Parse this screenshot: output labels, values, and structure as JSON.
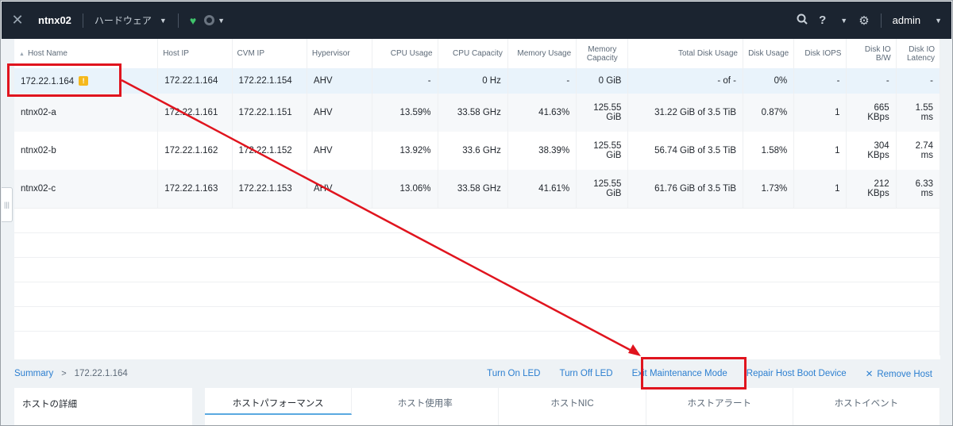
{
  "topbar": {
    "cluster_name": "ntnx02",
    "view_label": "ハードウェア",
    "admin_label": "admin",
    "help_label": "?"
  },
  "table": {
    "headers": [
      "Host Name",
      "Host IP",
      "CVM IP",
      "Hypervisor",
      "CPU Usage",
      "CPU Capacity",
      "Memory Usage",
      "Memory Capacity",
      "Total Disk Usage",
      "Disk Usage",
      "Disk IOPS",
      "Disk IO B/W",
      "Disk IO Latency"
    ],
    "rows": [
      [
        "172.22.1.164",
        "172.22.1.164",
        "172.22.1.154",
        "AHV",
        "-",
        "0 Hz",
        "-",
        "0 GiB",
        "- of -",
        "0%",
        "-",
        "-",
        "-"
      ],
      [
        "ntnx02-a",
        "172.22.1.161",
        "172.22.1.151",
        "AHV",
        "13.59%",
        "33.58 GHz",
        "41.63%",
        "125.55 GiB",
        "31.22 GiB of 3.5 TiB",
        "0.87%",
        "1",
        "665 KBps",
        "1.55 ms"
      ],
      [
        "ntnx02-b",
        "172.22.1.162",
        "172.22.1.152",
        "AHV",
        "13.92%",
        "33.6 GHz",
        "38.39%",
        "125.55 GiB",
        "56.74 GiB of 3.5 TiB",
        "1.58%",
        "1",
        "304 KBps",
        "2.74 ms"
      ],
      [
        "ntnx02-c",
        "172.22.1.163",
        "172.22.1.153",
        "AHV",
        "13.06%",
        "33.58 GHz",
        "41.61%",
        "125.55 GiB",
        "61.76 GiB of 3.5 TiB",
        "1.73%",
        "1",
        "212 KBps",
        "6.33 ms"
      ]
    ],
    "warning_badge": "!"
  },
  "breadcrumb": {
    "root": "Summary",
    "current": "172.22.1.164"
  },
  "actions": {
    "turn_on_led": "Turn On LED",
    "turn_off_led": "Turn Off LED",
    "exit_maintenance": "Exit Maintenance Mode",
    "repair_boot": "Repair Host Boot Device",
    "remove_host": "Remove Host"
  },
  "details": {
    "title": "ホストの詳細"
  },
  "tabs": [
    "ホストパフォーマンス",
    "ホスト使用率",
    "ホストNIC",
    "ホストアラート",
    "ホストイベント"
  ],
  "colors": {
    "topbar_bg": "#1b2430",
    "link": "#2c7fd0",
    "highlight_red": "#e0141e",
    "selected_row": "#e9f3fb",
    "warning": "#f5b81c",
    "health_green": "#3fc46b"
  }
}
